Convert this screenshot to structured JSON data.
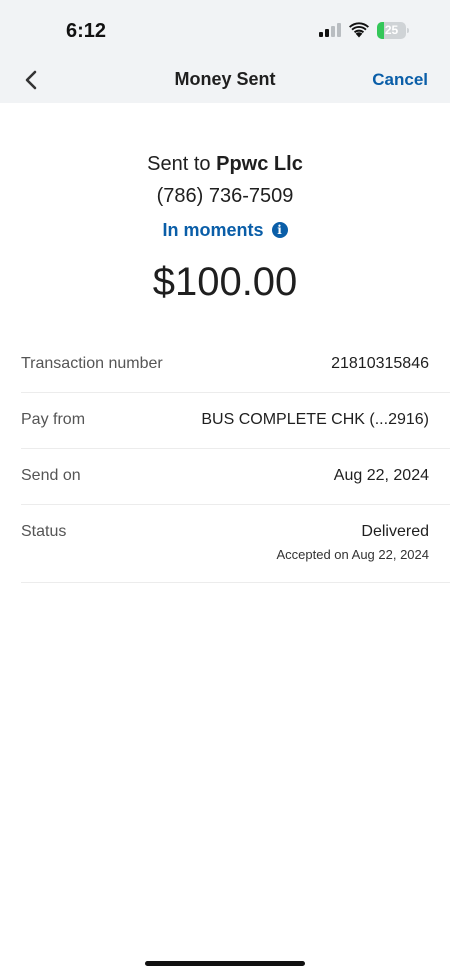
{
  "status_bar": {
    "time": "6:12",
    "battery": "25",
    "battery_fraction": 0.25,
    "signal_bars_active": 2,
    "signal_bars_total": 4
  },
  "nav": {
    "title": "Money Sent",
    "cancel_label": "Cancel"
  },
  "summary": {
    "sent_to_prefix": "Sent to",
    "recipient": "Ppwc Llc",
    "phone": "(786) 736-7509",
    "timing": "In moments",
    "amount": "$100.00"
  },
  "details": [
    {
      "label": "Transaction number",
      "value": "21810315846"
    },
    {
      "label": "Pay from",
      "value": "BUS COMPLETE CHK (...2916)"
    },
    {
      "label": "Send on",
      "value": "Aug 22, 2024"
    },
    {
      "label": "Status",
      "value": "Delivered",
      "sub": "Accepted on Aug 22, 2024"
    }
  ],
  "colors": {
    "accent": "#0a5ea8",
    "header_bg": "#f1f3f5",
    "battery_green": "#34c759"
  },
  "icons": {
    "back": "chevron-left-icon",
    "info": "info-icon",
    "wifi": "wifi-icon",
    "signal": "cellular-signal-icon",
    "battery": "battery-icon"
  }
}
